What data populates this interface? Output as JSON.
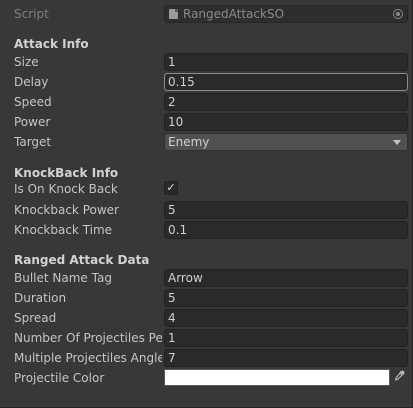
{
  "script_row": {
    "label": "Script",
    "value": "RangedAttackSO",
    "icon": "scriptable-object-icon",
    "picker_icon": "object-picker-icon"
  },
  "attack_info": {
    "header": "Attack Info",
    "size": {
      "label": "Size",
      "value": "1"
    },
    "delay": {
      "label": "Delay",
      "value": "0.15"
    },
    "speed": {
      "label": "Speed",
      "value": "2"
    },
    "power": {
      "label": "Power",
      "value": "10"
    },
    "target": {
      "label": "Target",
      "value": "Enemy"
    }
  },
  "knockback_info": {
    "header": "KnockBack Info",
    "is_on_knock_back": {
      "label": "Is On Knock Back",
      "checked": true,
      "mark": "✓"
    },
    "knockback_power": {
      "label": "Knockback Power",
      "value": "5"
    },
    "knockback_time": {
      "label": "Knockback Time",
      "value": "0.1"
    }
  },
  "ranged_attack_data": {
    "header": "Ranged Attack Data",
    "bullet_name_tag": {
      "label": "Bullet Name Tag",
      "value": "Arrow"
    },
    "duration": {
      "label": "Duration",
      "value": "5"
    },
    "spread": {
      "label": "Spread",
      "value": "4"
    },
    "number_of_projectiles": {
      "label": "Number Of Projectiles Per",
      "value": "1"
    },
    "multiple_projectiles_angle": {
      "label": "Multiple Projectiles Angle",
      "value": "7"
    },
    "projectile_color": {
      "label": "Projectile Color",
      "color": "#ffffff",
      "eyedropper_icon": "eyedropper-icon"
    }
  }
}
